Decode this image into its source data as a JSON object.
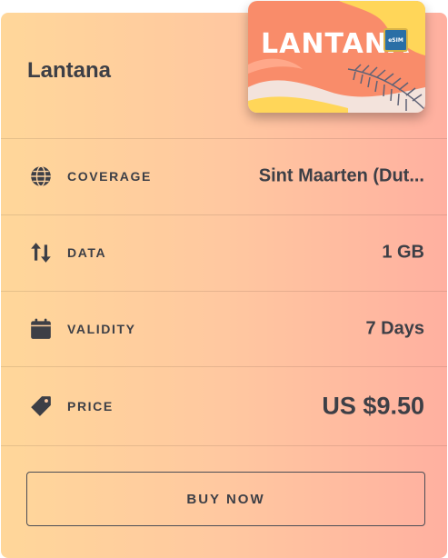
{
  "card": {
    "title": "Lantana",
    "sim_logo": "LANTANA",
    "sim_badge": "eSIM"
  },
  "rows": [
    {
      "icon": "globe-icon",
      "label": "COVERAGE",
      "value": "Sint Maarten (Dut..."
    },
    {
      "icon": "arrows-up-down-icon",
      "label": "DATA",
      "value": "1 GB"
    },
    {
      "icon": "calendar-icon",
      "label": "VALIDITY",
      "value": "7 Days"
    },
    {
      "icon": "price-tag-icon",
      "label": "PRICE",
      "value": "US $9.50"
    }
  ],
  "buy_button": {
    "label": "BUY NOW"
  },
  "colors": {
    "text": "#3d3f46",
    "gradient_start": "#ffd79a",
    "gradient_end": "#ffb0a0",
    "sim_orange": "#f98c6a",
    "sim_yellow": "#ffd659"
  }
}
